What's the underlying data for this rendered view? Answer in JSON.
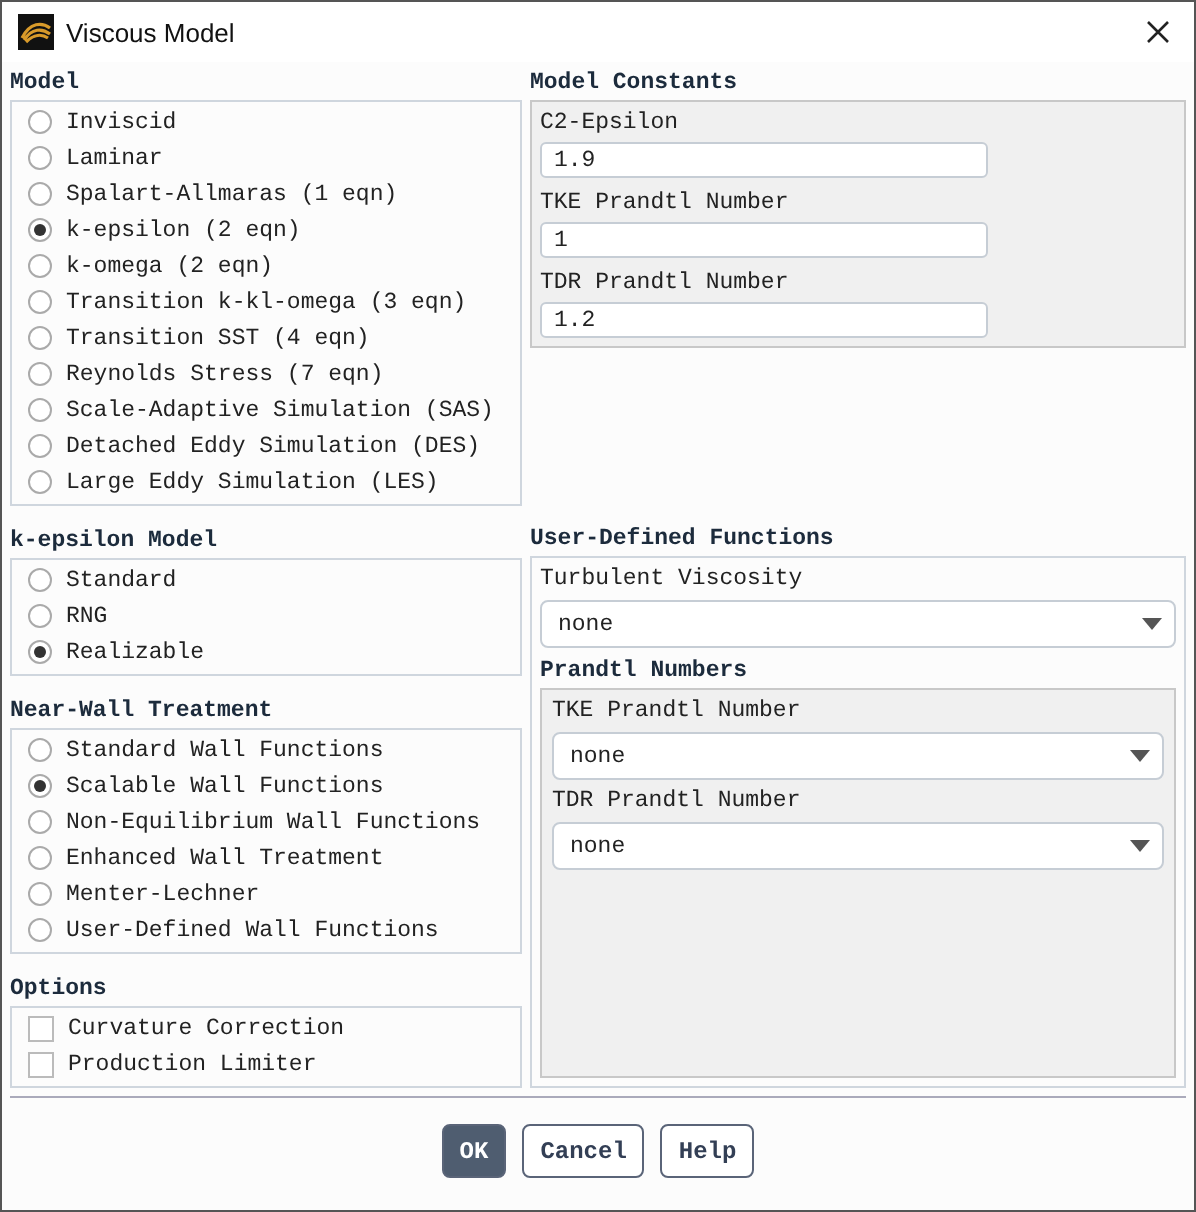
{
  "window": {
    "title": "Viscous Model"
  },
  "model": {
    "title": "Model",
    "options": [
      {
        "label": "Inviscid",
        "selected": false
      },
      {
        "label": "Laminar",
        "selected": false
      },
      {
        "label": "Spalart-Allmaras (1 eqn)",
        "selected": false
      },
      {
        "label": "k-epsilon (2 eqn)",
        "selected": true
      },
      {
        "label": "k-omega (2 eqn)",
        "selected": false
      },
      {
        "label": "Transition k-kl-omega (3 eqn)",
        "selected": false
      },
      {
        "label": "Transition SST (4 eqn)",
        "selected": false
      },
      {
        "label": "Reynolds Stress (7 eqn)",
        "selected": false
      },
      {
        "label": "Scale-Adaptive Simulation (SAS)",
        "selected": false
      },
      {
        "label": "Detached Eddy Simulation (DES)",
        "selected": false
      },
      {
        "label": "Large Eddy Simulation (LES)",
        "selected": false
      }
    ]
  },
  "k_epsilon_model": {
    "title": "k-epsilon Model",
    "options": [
      {
        "label": "Standard",
        "selected": false
      },
      {
        "label": "RNG",
        "selected": false
      },
      {
        "label": "Realizable",
        "selected": true
      }
    ]
  },
  "near_wall_treatment": {
    "title": "Near-Wall Treatment",
    "options": [
      {
        "label": "Standard Wall Functions",
        "selected": false
      },
      {
        "label": "Scalable Wall Functions",
        "selected": true
      },
      {
        "label": "Non-Equilibrium Wall Functions",
        "selected": false
      },
      {
        "label": "Enhanced Wall Treatment",
        "selected": false
      },
      {
        "label": "Menter-Lechner",
        "selected": false
      },
      {
        "label": "User-Defined Wall Functions",
        "selected": false
      }
    ]
  },
  "options": {
    "title": "Options",
    "items": [
      {
        "label": "Curvature Correction",
        "checked": false
      },
      {
        "label": "Production Limiter",
        "checked": false
      }
    ]
  },
  "model_constants": {
    "title": "Model Constants",
    "fields": [
      {
        "label": "C2-Epsilon",
        "value": "1.9"
      },
      {
        "label": "TKE Prandtl Number",
        "value": "1"
      },
      {
        "label": "TDR Prandtl Number",
        "value": "1.2"
      }
    ]
  },
  "user_defined_functions": {
    "title": "User-Defined Functions",
    "turbulent_viscosity": {
      "label": "Turbulent Viscosity",
      "value": "none"
    },
    "prandtl_numbers": {
      "title": "Prandtl Numbers",
      "fields": [
        {
          "label": "TKE Prandtl Number",
          "value": "none"
        },
        {
          "label": "TDR Prandtl Number",
          "value": "none"
        }
      ]
    }
  },
  "buttons": [
    {
      "label": "OK",
      "default": true
    },
    {
      "label": "Cancel",
      "default": false
    },
    {
      "label": "Help",
      "default": false
    }
  ]
}
